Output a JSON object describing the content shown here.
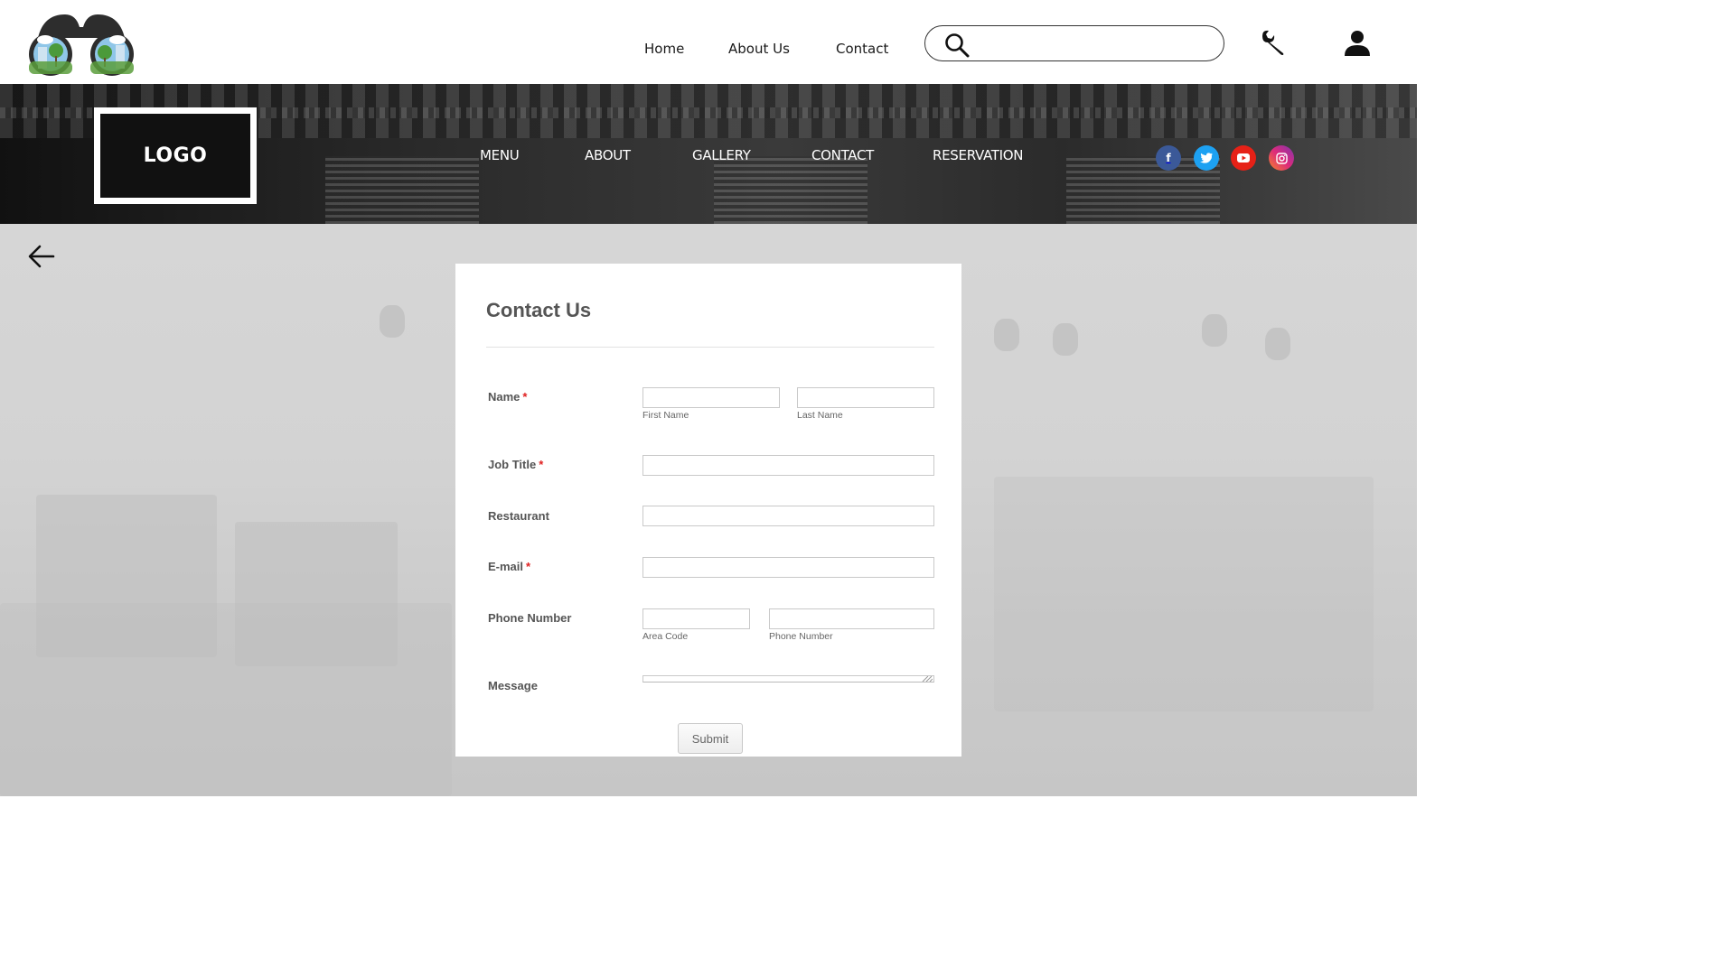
{
  "topbar": {
    "nav": [
      "Home",
      "About Us",
      "Contact"
    ],
    "search": {
      "placeholder": "",
      "value": ""
    }
  },
  "hero": {
    "logo_text": "LOGO",
    "nav": [
      "MENU",
      "ABOUT",
      "GALLERY",
      "CONTACT",
      "RESERVATION"
    ],
    "social": [
      {
        "name": "facebook",
        "color": "#3b5998",
        "glyph": "f"
      },
      {
        "name": "twitter",
        "color": "#1da1f2",
        "glyph": ""
      },
      {
        "name": "youtube",
        "color": "#e62117",
        "glyph": ""
      },
      {
        "name": "instagram",
        "color": "#c13584",
        "glyph": ""
      }
    ]
  },
  "form": {
    "title": "Contact Us",
    "required_mark": "*",
    "name": {
      "label": "Name",
      "first": "First Name",
      "last": "Last Name"
    },
    "job_title": {
      "label": "Job Title"
    },
    "restaurant": {
      "label": "Restaurant"
    },
    "email": {
      "label": "E-mail"
    },
    "phone": {
      "label": "Phone Number",
      "area": "Area Code",
      "number": "Phone Number"
    },
    "message": {
      "label": "Message"
    },
    "submit": "Submit"
  },
  "colors": {
    "required": "#e02020",
    "label": "#555555",
    "hero_text": "#ffffff"
  }
}
